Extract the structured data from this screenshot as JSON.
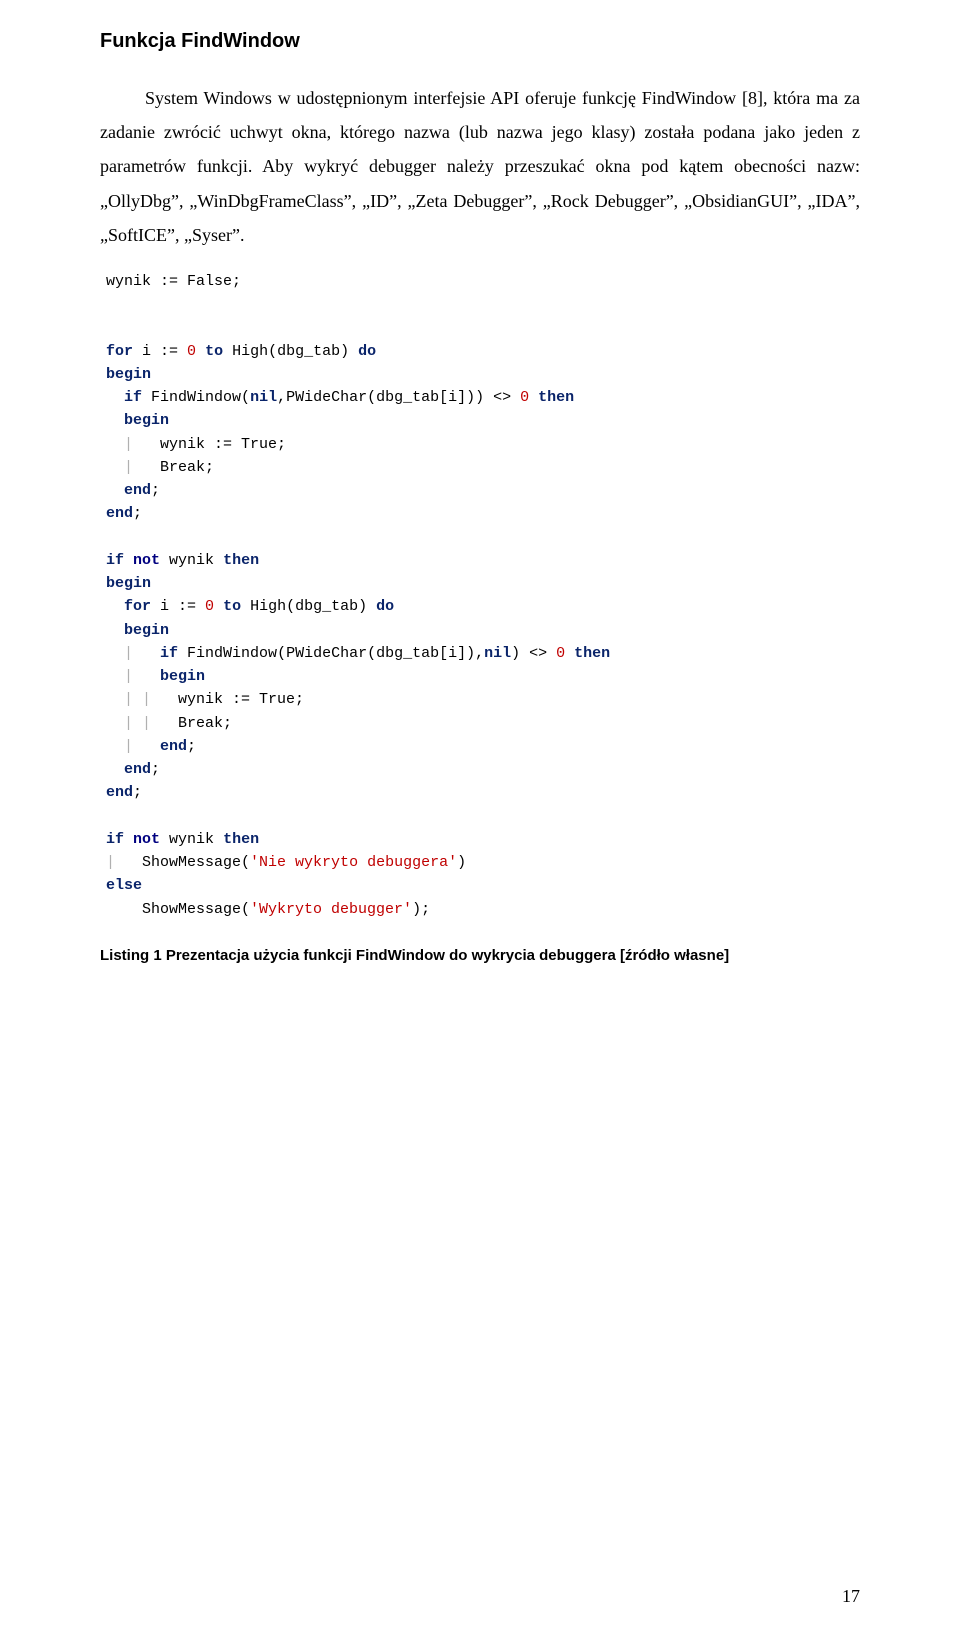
{
  "title": "Funkcja FindWindow",
  "paragraph": "System Windows w udostępnionym interfejsie API oferuje funkcję FindWindow [8], która ma za zadanie zwrócić uchwyt okna, którego nazwa (lub nazwa jego klasy) została podana jako jeden z parametrów funkcji. Aby wykryć debugger należy przeszukać okna pod kątem obecności nazw: „OllyDbg”, „WinDbgFrameClass”, „ID”, „Zeta Debugger”, „Rock Debugger”, „ObsidianGUI”, „IDA”, „SoftICE”, „Syser”.",
  "code_lines": [
    [
      {
        "cls": "plain",
        "t": "wynik := False;"
      }
    ],
    [
      {
        "cls": "plain",
        "t": ""
      }
    ],
    [
      {
        "cls": "plain",
        "t": ""
      }
    ],
    [
      {
        "cls": "kw",
        "t": "for"
      },
      {
        "cls": "plain",
        "t": " i := "
      },
      {
        "cls": "num",
        "t": "0"
      },
      {
        "cls": "plain",
        "t": " "
      },
      {
        "cls": "kw",
        "t": "to"
      },
      {
        "cls": "plain",
        "t": " High(dbg_tab) "
      },
      {
        "cls": "kw",
        "t": "do"
      }
    ],
    [
      {
        "cls": "kw",
        "t": "begin"
      }
    ],
    [
      {
        "cls": "guide",
        "t": "  "
      },
      {
        "cls": "kw",
        "t": "if"
      },
      {
        "cls": "plain",
        "t": " FindWindow("
      },
      {
        "cls": "kw",
        "t": "nil"
      },
      {
        "cls": "plain",
        "t": ",PWideChar(dbg_tab[i])) <> "
      },
      {
        "cls": "num",
        "t": "0"
      },
      {
        "cls": "plain",
        "t": " "
      },
      {
        "cls": "kw",
        "t": "then"
      }
    ],
    [
      {
        "cls": "guide",
        "t": "  "
      },
      {
        "cls": "kw",
        "t": "begin"
      }
    ],
    [
      {
        "cls": "guide",
        "t": "  | "
      },
      {
        "cls": "plain",
        "t": "  wynik := True;"
      }
    ],
    [
      {
        "cls": "guide",
        "t": "  | "
      },
      {
        "cls": "plain",
        "t": "  Break;"
      }
    ],
    [
      {
        "cls": "guide",
        "t": "  "
      },
      {
        "cls": "kw",
        "t": "end"
      },
      {
        "cls": "plain",
        "t": ";"
      }
    ],
    [
      {
        "cls": "kw",
        "t": "end"
      },
      {
        "cls": "plain",
        "t": ";"
      }
    ],
    [
      {
        "cls": "plain",
        "t": ""
      }
    ],
    [
      {
        "cls": "kw",
        "t": "if"
      },
      {
        "cls": "plain",
        "t": " "
      },
      {
        "cls": "kwnot",
        "t": "not"
      },
      {
        "cls": "plain",
        "t": " wynik "
      },
      {
        "cls": "kw",
        "t": "then"
      }
    ],
    [
      {
        "cls": "kw",
        "t": "begin"
      }
    ],
    [
      {
        "cls": "guide",
        "t": "  "
      },
      {
        "cls": "kw",
        "t": "for"
      },
      {
        "cls": "plain",
        "t": " i := "
      },
      {
        "cls": "num",
        "t": "0"
      },
      {
        "cls": "plain",
        "t": " "
      },
      {
        "cls": "kw",
        "t": "to"
      },
      {
        "cls": "plain",
        "t": " High(dbg_tab) "
      },
      {
        "cls": "kw",
        "t": "do"
      }
    ],
    [
      {
        "cls": "guide",
        "t": "  "
      },
      {
        "cls": "kw",
        "t": "begin"
      }
    ],
    [
      {
        "cls": "guide",
        "t": "  | "
      },
      {
        "cls": "plain",
        "t": "  "
      },
      {
        "cls": "kw",
        "t": "if"
      },
      {
        "cls": "plain",
        "t": " FindWindow(PWideChar(dbg_tab[i]),"
      },
      {
        "cls": "kw",
        "t": "nil"
      },
      {
        "cls": "plain",
        "t": ") <> "
      },
      {
        "cls": "num",
        "t": "0"
      },
      {
        "cls": "plain",
        "t": " "
      },
      {
        "cls": "kw",
        "t": "then"
      }
    ],
    [
      {
        "cls": "guide",
        "t": "  | "
      },
      {
        "cls": "plain",
        "t": "  "
      },
      {
        "cls": "kw",
        "t": "begin"
      }
    ],
    [
      {
        "cls": "guide",
        "t": "  | | "
      },
      {
        "cls": "plain",
        "t": "  wynik := True;"
      }
    ],
    [
      {
        "cls": "guide",
        "t": "  | | "
      },
      {
        "cls": "plain",
        "t": "  Break;"
      }
    ],
    [
      {
        "cls": "guide",
        "t": "  | "
      },
      {
        "cls": "plain",
        "t": "  "
      },
      {
        "cls": "kw",
        "t": "end"
      },
      {
        "cls": "plain",
        "t": ";"
      }
    ],
    [
      {
        "cls": "guide",
        "t": "  "
      },
      {
        "cls": "kw",
        "t": "end"
      },
      {
        "cls": "plain",
        "t": ";"
      }
    ],
    [
      {
        "cls": "kw",
        "t": "end"
      },
      {
        "cls": "plain",
        "t": ";"
      }
    ],
    [
      {
        "cls": "plain",
        "t": ""
      }
    ],
    [
      {
        "cls": "kw",
        "t": "if"
      },
      {
        "cls": "plain",
        "t": " "
      },
      {
        "cls": "kwnot",
        "t": "not"
      },
      {
        "cls": "plain",
        "t": " wynik "
      },
      {
        "cls": "kw",
        "t": "then"
      }
    ],
    [
      {
        "cls": "guide",
        "t": "| "
      },
      {
        "cls": "plain",
        "t": "  ShowMessage("
      },
      {
        "cls": "str",
        "t": "'Nie wykryto debuggera'"
      },
      {
        "cls": "plain",
        "t": ")"
      }
    ],
    [
      {
        "cls": "kw",
        "t": "else"
      }
    ],
    [
      {
        "cls": "plain",
        "t": "    ShowMessage("
      },
      {
        "cls": "str",
        "t": "'Wykryto debugger'"
      },
      {
        "cls": "plain",
        "t": ");"
      }
    ]
  ],
  "caption": "Listing 1 Prezentacja użycia funkcji FindWindow do wykrycia debuggera [źródło własne]",
  "page_number": "17"
}
